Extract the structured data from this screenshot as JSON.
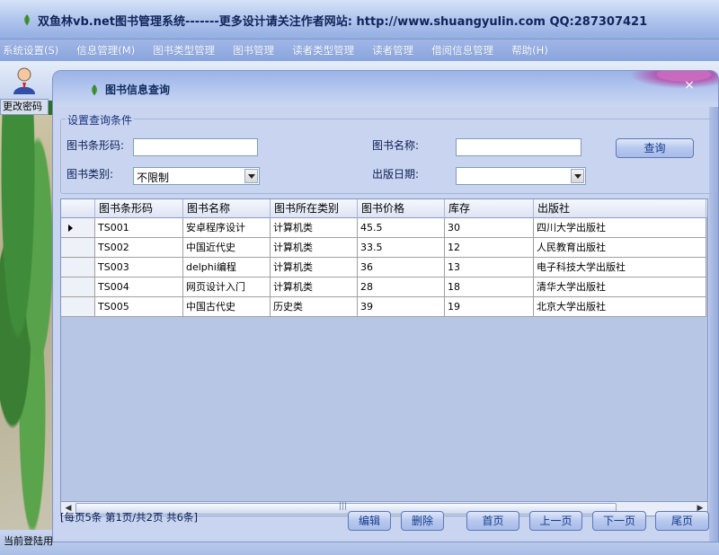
{
  "window": {
    "title": "双鱼林vb.net图书管理系统-------更多设计请关注作者网站:  http://www.shuangyulin.com  QQ:287307421"
  },
  "menu": [
    "系统设置(S)",
    "信息管理(M)",
    "图书类型管理",
    "图书管理",
    "读者类型管理",
    "读者管理",
    "借阅信息管理",
    "帮助(H)"
  ],
  "toolbar": {
    "change_password_label": "更改密码"
  },
  "status": {
    "text": "当前登陆用"
  },
  "child": {
    "title": "图书信息查询",
    "close": "×"
  },
  "query": {
    "legend": "设置查询条件",
    "barcode_label": "图书条形码:",
    "barcode_value": "",
    "name_label": "图书名称:",
    "name_value": "",
    "type_label": "图书类别:",
    "type_value": "不限制",
    "date_label": "出版日期:",
    "date_value": "",
    "search_button": "查询"
  },
  "grid": {
    "columns": [
      "图书条形码",
      "图书名称",
      "图书所在类别",
      "图书价格",
      "库存",
      "出版社"
    ],
    "rows": [
      [
        "TS001",
        "安卓程序设计",
        "计算机类",
        "45.5",
        "30",
        "四川大学出版社"
      ],
      [
        "TS002",
        "中国近代史",
        "计算机类",
        "33.5",
        "12",
        "人民教育出版社"
      ],
      [
        "TS003",
        "delphi编程",
        "计算机类",
        "36",
        "13",
        "电子科技大学出版社"
      ],
      [
        "TS004",
        "网页设计入门",
        "计算机类",
        "28",
        "18",
        "清华大学出版社"
      ],
      [
        "TS005",
        "中国古代史",
        "历史类",
        "39",
        "19",
        "北京大学出版社"
      ]
    ]
  },
  "pager": {
    "info": "[每页5条 第1页/共2页    共6条]",
    "edit": "编辑",
    "delete": "删除",
    "first": "首页",
    "prev": "上一页",
    "next": "下一页",
    "last": "尾页"
  },
  "colors": {
    "window_bg": "#c9d5f0",
    "header": "#9bb3e6",
    "accent_pink": "#d05bb7"
  }
}
